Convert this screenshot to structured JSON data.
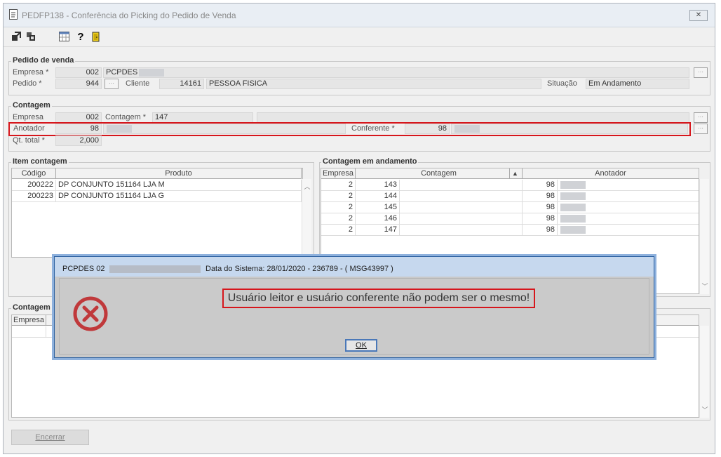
{
  "window": {
    "title": "PEDFP138 - Conferência do Picking do Pedido de Venda",
    "close_symbol": "✕"
  },
  "toolbar": {
    "icons": [
      "exit-icon",
      "windows-icon",
      "calendar-icon",
      "help-icon",
      "door-icon"
    ]
  },
  "pedido": {
    "title": "Pedido de venda",
    "empresa_label": "Empresa *",
    "empresa_value": "002",
    "empresa_name": "PCPDES",
    "pedido_label": "Pedido *",
    "pedido_value": "944",
    "cliente_label": "Cliente",
    "cliente_value": "14161",
    "cliente_name": "PESSOA FISICA",
    "situacao_label": "Situação",
    "situacao_value": "Em Andamento"
  },
  "contagem": {
    "title": "Contagem",
    "empresa_label": "Empresa",
    "empresa_value": "002",
    "contagem_label": "Contagem *",
    "contagem_value": "147",
    "anotador_label": "Anotador",
    "anotador_value": "98",
    "conferente_label": "Conferente *",
    "conferente_value": "98",
    "qt_total_label": "Qt. total *",
    "qt_total_value": "2,000"
  },
  "item_contagem": {
    "title": "Item contagem",
    "columns": [
      "Código",
      "Produto"
    ],
    "rows": [
      {
        "codigo": "200222",
        "produto": "DP CONJUNTO 151164 LJA M"
      },
      {
        "codigo": "200223",
        "produto": "DP CONJUNTO 151164 LJA G"
      }
    ]
  },
  "contagem_andamento": {
    "title": "Contagem em andamento",
    "columns": [
      "Empresa",
      "Contagem",
      "Anotador"
    ],
    "sort_icon": "sort-up-icon",
    "rows": [
      {
        "empresa": "2",
        "contagem": "143",
        "anotador": "98"
      },
      {
        "empresa": "2",
        "contagem": "144",
        "anotador": "98"
      },
      {
        "empresa": "2",
        "contagem": "145",
        "anotador": "98"
      },
      {
        "empresa": "2",
        "contagem": "146",
        "anotador": "98"
      },
      {
        "empresa": "2",
        "contagem": "147",
        "anotador": "98"
      }
    ]
  },
  "contagem_bottom": {
    "title": "Contagem",
    "columns": [
      "Empresa"
    ]
  },
  "footer": {
    "encerrar_label": "Encerrar"
  },
  "dialog": {
    "title_prefix": "PCPDES 02",
    "title_suffix": "Data do Sistema: 28/01/2020 - 236789 - ( MSG43997 )",
    "message": "Usuário leitor e usuário conferente não podem ser o mesmo!",
    "ok_label": "OK",
    "icon": "error-icon",
    "error_color": "#c0393b",
    "highlight_color": "#d6161c"
  }
}
